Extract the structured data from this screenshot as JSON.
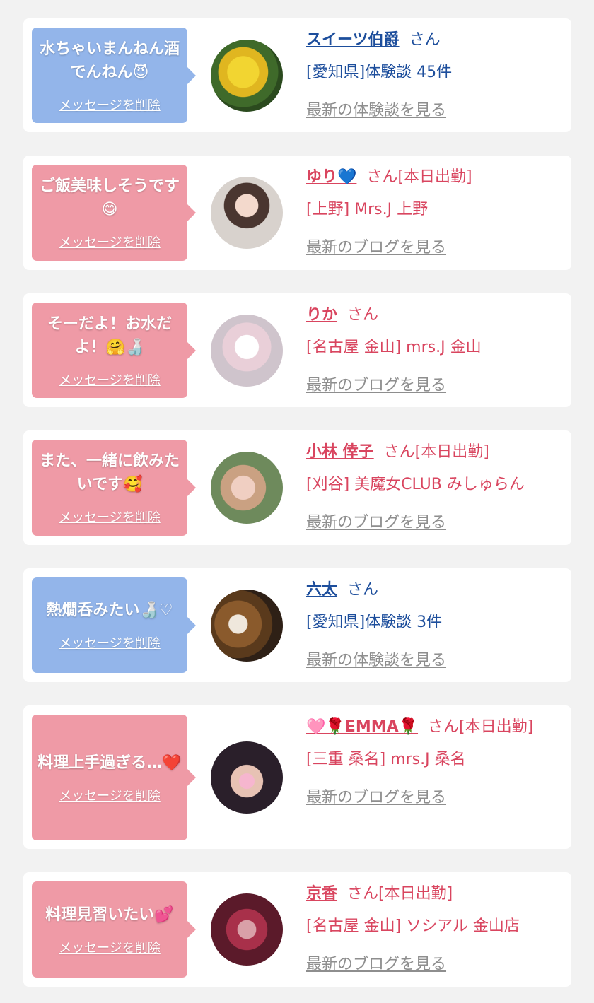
{
  "items": [
    {
      "message": "水ちゃいまんねん酒でんねん😈",
      "delete_label": "メッセージを削除",
      "name": "スイーツ伯爵",
      "suffix": "さん",
      "detail": "[愛知県]体験談 45件",
      "link": "最新の体験談を見る",
      "bubble_color": "#93b5ea",
      "text_color": "#1d4e9c"
    },
    {
      "message": "ご飯美味しそうです😋",
      "delete_label": "メッセージを削除",
      "name": "ゆり💙",
      "suffix": "さん[本日出勤]",
      "detail": "[上野] Mrs.J 上野",
      "link": "最新のブログを見る",
      "bubble_color": "#ef9aa6",
      "text_color": "#d9455f"
    },
    {
      "message": "そーだよ！お水だよ！🤗🍶",
      "delete_label": "メッセージを削除",
      "name": "りか",
      "suffix": "さん",
      "detail": "[名古屋 金山] mrs.J 金山",
      "link": "最新のブログを見る",
      "bubble_color": "#ef9aa6",
      "text_color": "#d9455f"
    },
    {
      "message": "また、一緒に飲みたいです🥰",
      "delete_label": "メッセージを削除",
      "name": "小林 倖子",
      "suffix": "さん[本日出勤]",
      "detail": "[刈谷] 美魔女CLUB みしゅらん",
      "link": "最新のブログを見る",
      "bubble_color": "#ef9aa6",
      "text_color": "#d9455f"
    },
    {
      "message": "熱燗呑みたい🍶♡",
      "delete_label": "メッセージを削除",
      "name": "六太",
      "suffix": "さん",
      "detail": "[愛知県]体験談 3件",
      "link": "最新の体験談を見る",
      "bubble_color": "#93b5ea",
      "text_color": "#1d4e9c"
    },
    {
      "message": "料理上手過ぎる…❤️",
      "delete_label": "メッセージを削除",
      "name": "🩷🌹EMMA🌹",
      "suffix": "さん[本日出勤]",
      "detail": "[三重 桑名] mrs.J 桑名",
      "link": "最新のブログを見る",
      "bubble_color": "#ef9aa6",
      "text_color": "#d9455f"
    },
    {
      "message": "料理見習いたい💕",
      "delete_label": "メッセージを削除",
      "name": "京香",
      "suffix": "さん[本日出勤]",
      "detail": "[名古屋 金山] ソシアル 金山店",
      "link": "最新のブログを見る",
      "bubble_color": "#ef9aa6",
      "text_color": "#d9455f"
    }
  ]
}
